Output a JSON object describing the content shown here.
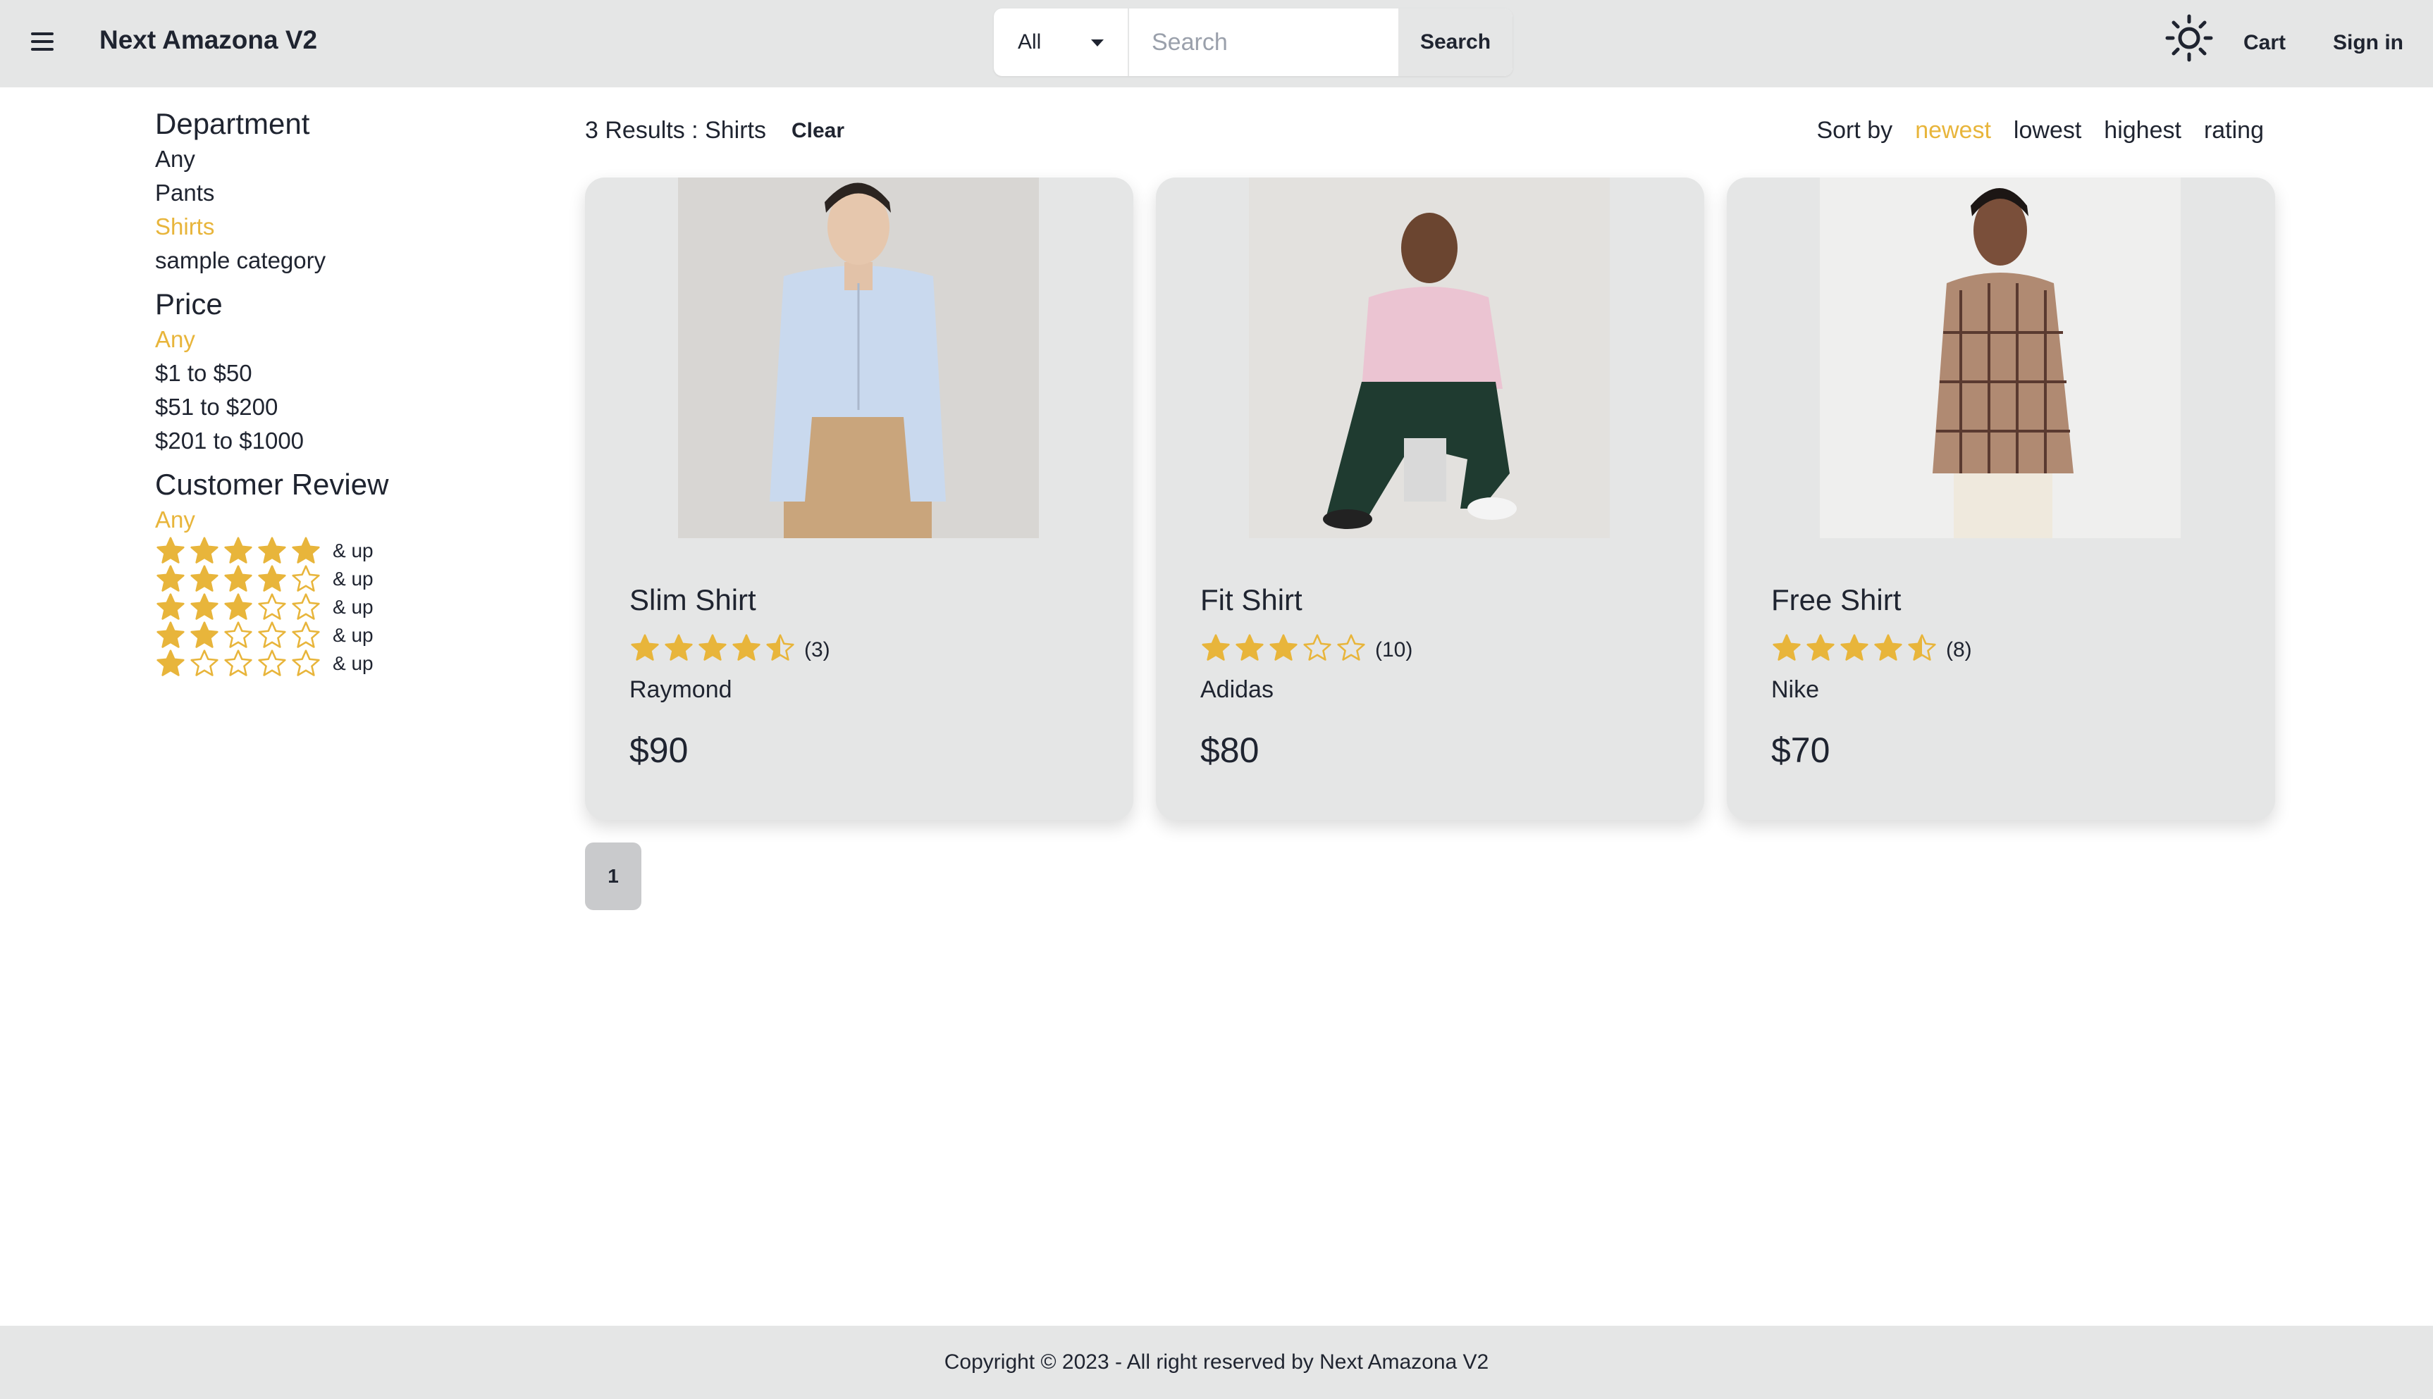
{
  "header": {
    "brand": "Next Amazona V2",
    "search": {
      "category_selected": "All",
      "placeholder": "Search",
      "button_label": "Search"
    },
    "cart_label": "Cart",
    "signin_label": "Sign in",
    "icons": [
      "menu-icon",
      "sun-icon",
      "caret-down-icon"
    ]
  },
  "sidebar": {
    "department": {
      "heading": "Department",
      "items": [
        "Any",
        "Pants",
        "Shirts",
        "sample category"
      ],
      "active": "Shirts"
    },
    "price": {
      "heading": "Price",
      "items": [
        "Any",
        "$1 to $50",
        "$51 to $200",
        "$201 to $1000"
      ],
      "active": "Any"
    },
    "review": {
      "heading": "Customer Review",
      "any_label": "Any",
      "up_label": "& up",
      "levels": [
        5,
        4,
        3,
        2,
        1
      ]
    }
  },
  "results": {
    "summary": "3 Results : Shirts",
    "clear_label": "Clear"
  },
  "sort": {
    "label": "Sort by",
    "options": [
      "newest",
      "lowest",
      "highest",
      "rating"
    ],
    "active": "newest"
  },
  "products": [
    {
      "name": "Slim Shirt",
      "rating": 4.5,
      "reviews": "(3)",
      "brand": "Raymond",
      "price": "$90"
    },
    {
      "name": "Fit Shirt",
      "rating": 3,
      "reviews": "(10)",
      "brand": "Adidas",
      "price": "$80"
    },
    {
      "name": "Free Shirt",
      "rating": 4.5,
      "reviews": "(8)",
      "brand": "Nike",
      "price": "$70"
    }
  ],
  "pagination": {
    "current": "1"
  },
  "footer": {
    "text": "Copyright © 2023 - All right reserved by Next Amazona V2"
  },
  "colors": {
    "accent": "#e8b53b",
    "header_bg": "#e5e6e6",
    "card_bg": "#e5e6e6",
    "text": "#1f2430"
  }
}
